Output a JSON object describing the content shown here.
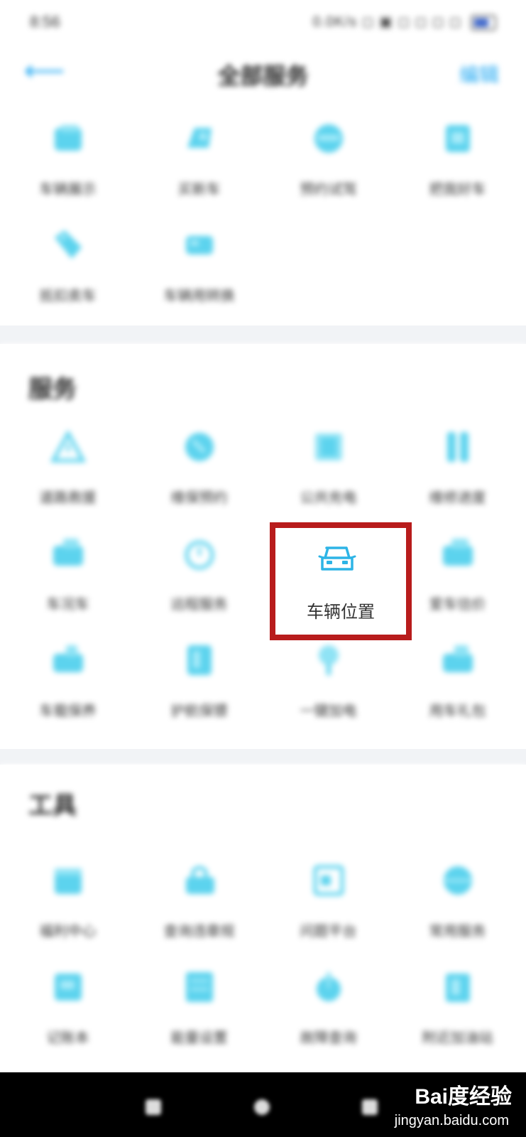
{
  "status": {
    "time": "8:56",
    "right_text": "0.0K/s ◻ ▣ ◻ ◻ ◻ ◻"
  },
  "header": {
    "title": "全部服务",
    "edit_label": "编辑"
  },
  "colors": {
    "accent": "#23a9f2",
    "highlight_border": "#b81c1c"
  },
  "top_section": {
    "items": [
      {
        "label": "车辆展示",
        "icon": "car-display-icon"
      },
      {
        "label": "买新车",
        "icon": "new-car-icon"
      },
      {
        "label": "预约试驾",
        "icon": "test-drive-icon"
      },
      {
        "label": "把我好车",
        "icon": "good-car-icon"
      },
      {
        "label": "抵扣卖车",
        "icon": "tag-icon"
      },
      {
        "label": "车辆用转换",
        "icon": "car-convert-icon"
      }
    ]
  },
  "services": {
    "title": "服务",
    "items": [
      {
        "label": "道路救援",
        "icon": "warning-triangle-icon"
      },
      {
        "label": "维保预约",
        "icon": "maintenance-icon"
      },
      {
        "label": "公共充电",
        "icon": "charging-icon"
      },
      {
        "label": "维修进度",
        "icon": "progress-icon"
      },
      {
        "label": "车况车",
        "icon": "car-status-icon"
      },
      {
        "label": "远程服务",
        "icon": "timer-icon"
      },
      {
        "label": "车辆位置",
        "icon": "car-location-icon",
        "highlighted": true
      },
      {
        "label": "爱车估价",
        "icon": "car-value-icon"
      },
      {
        "label": "车载保养",
        "icon": "car-care-icon"
      },
      {
        "label": "护航保镖",
        "icon": "guard-icon"
      },
      {
        "label": "一键加电",
        "icon": "bolt-icon"
      },
      {
        "label": "用车礼包",
        "icon": "gift-icon"
      }
    ]
  },
  "tools": {
    "title": "工具",
    "items": [
      {
        "label": "福利中心",
        "icon": "calendar-icon"
      },
      {
        "label": "查询违章规",
        "icon": "lock-car-icon"
      },
      {
        "label": "问题平台",
        "icon": "platform-icon"
      },
      {
        "label": "常用服务",
        "icon": "globe-icon"
      },
      {
        "label": "记账本",
        "icon": "notebook-icon"
      },
      {
        "label": "能量设置",
        "icon": "list-icon"
      },
      {
        "label": "故障查询",
        "icon": "download-icon"
      },
      {
        "label": "附近加油站",
        "icon": "fuel-icon"
      }
    ]
  },
  "watermark": {
    "brand": "Bai度经验",
    "url": "jingyan.baidu.com"
  }
}
